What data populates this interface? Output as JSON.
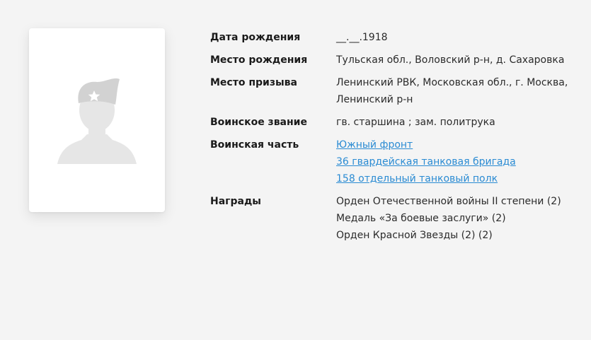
{
  "profile": {
    "photo_alt": "placeholder soldier silhouette"
  },
  "fields": {
    "birth_date": {
      "label": "Дата рождения",
      "value": "__.__.1918"
    },
    "birth_place": {
      "label": "Место рождения",
      "value": "Тульская обл., Воловский р-н, д. Сахаровка"
    },
    "draft_place": {
      "label": "Место призыва",
      "lines": [
        "Ленинский РВК, Московская обл., г. Москва,",
        "Ленинский р-н"
      ]
    },
    "rank": {
      "label": "Воинское звание",
      "value": "гв. старшина ; зам. политрука"
    },
    "unit": {
      "label": "Воинская часть",
      "links": [
        "Южный фронт",
        "36 гвардейская танковая бригада",
        "158 отдельный танковый полк"
      ]
    },
    "awards": {
      "label": "Награды",
      "items": [
        "Орден Отечественной войны II степени (2)",
        "Медаль «За боевые заслуги» (2)",
        "Орден Красной Звезды (2) (2)"
      ]
    }
  },
  "colors": {
    "link": "#2a8bd3",
    "background": "#f4f4f4",
    "silhouette": "#e6e6e6"
  }
}
